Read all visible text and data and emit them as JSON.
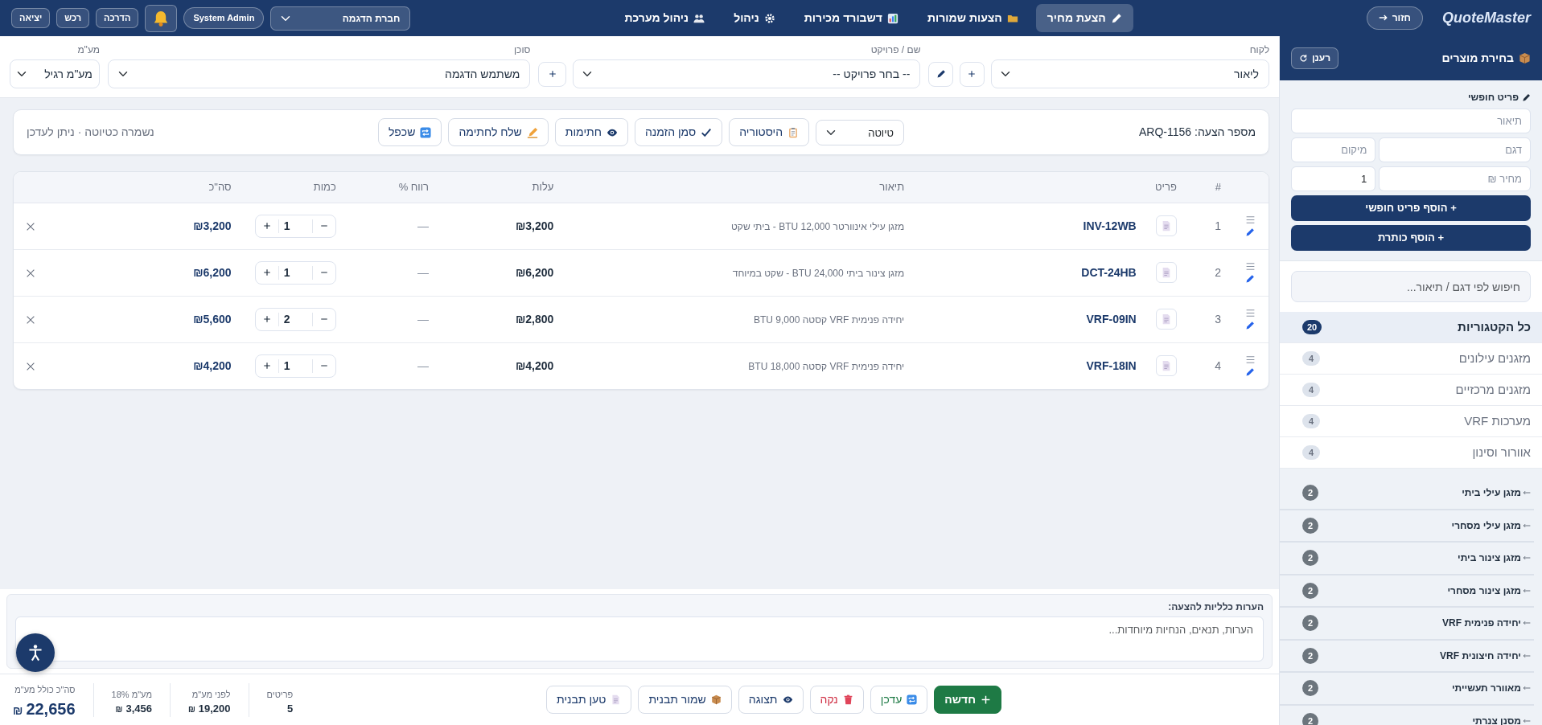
{
  "topbar": {
    "logo": "QuoteMaster",
    "back_button": "חזור",
    "nav": [
      {
        "label": "הצעת מחיר",
        "selected": true
      },
      {
        "label": "הצעות שמורות",
        "selected": false
      },
      {
        "label": "דשבורד מכירות",
        "selected": false
      },
      {
        "label": "ניהול",
        "selected": false
      },
      {
        "label": "ניהול מערכת",
        "selected": false
      }
    ],
    "company": "חברת הדגמה",
    "user": "System Admin",
    "buttons": [
      "הדרכה",
      "רכש",
      "יציאה"
    ]
  },
  "quote_fields": [
    {
      "label": "לקוח",
      "value": "ליאור",
      "actions": [
        {
          "kind": "add"
        },
        {
          "kind": "edit"
        }
      ]
    },
    {
      "label": "שם / פרויקט",
      "value": "-- בחר פרויקט --",
      "actions": [
        {
          "kind": "add"
        }
      ]
    },
    {
      "label": "סוכן",
      "value": "משתמש הדגמה"
    },
    {
      "label": "מע\"מ",
      "value": "מע\"מ רגיל"
    }
  ],
  "toolbar": {
    "quote_number": "מספר הצעה: ARQ-1156",
    "status": "טיוטה",
    "buttons": [
      "היסטוריה",
      "סמן הזמנה",
      "חתימות",
      "שלח לחתימה",
      "שכפל"
    ],
    "save_state": "נשמרה כטיוטה · ניתן לעדכן"
  },
  "table": {
    "columns": [
      "#",
      "פריט",
      "תיאור",
      "עלות",
      "רווח %",
      "כמות",
      "סה\"כ"
    ],
    "rows": [
      {
        "index": "1",
        "sku": "INV-12WB",
        "description": "מזגן עילי אינוורטר 12,000 BTU - ביתי שקט",
        "cost": "₪3,200",
        "profit": "—",
        "qty": "1",
        "total": "₪3,200"
      },
      {
        "index": "2",
        "sku": "DCT-24HB",
        "description": "מזגן צינור ביתי 24,000 BTU - שקט במיוחד",
        "cost": "₪6,200",
        "profit": "—",
        "qty": "1",
        "total": "₪6,200"
      },
      {
        "index": "3",
        "sku": "VRF-09IN",
        "description": "יחידה פנימית VRF קסטה 9,000 BTU",
        "cost": "₪2,800",
        "profit": "—",
        "qty": "2",
        "total": "₪5,600"
      },
      {
        "index": "4",
        "sku": "VRF-18IN",
        "description": "יחידה פנימית VRF קסטה 18,000 BTU",
        "cost": "₪4,200",
        "profit": "—",
        "qty": "1",
        "total": "₪4,200"
      }
    ]
  },
  "notes": {
    "label": "הערות כלליות להצעה:",
    "placeholder": "הערות, תנאים, הנחיות מיוחדות..."
  },
  "footer": {
    "buttons": [
      {
        "label": "חדשה",
        "kind": "new"
      },
      {
        "label": "עדכן",
        "kind": "update"
      },
      {
        "label": "נקה",
        "kind": "clear"
      },
      {
        "label": "תצוגה",
        "kind": "preview"
      },
      {
        "label": "שמור תבנית",
        "kind": "save"
      },
      {
        "label": "טען תבנית",
        "kind": "load"
      }
    ],
    "summary": [
      {
        "label": "פריטים",
        "value": "5",
        "kind": "plain"
      },
      {
        "label": "לפני מע\"מ",
        "value": "19,200",
        "currency": "₪",
        "kind": "plain"
      },
      {
        "label": "מע\"מ 18%",
        "value": "3,456",
        "currency": "₪",
        "kind": "plain"
      },
      {
        "label": "סה\"כ כולל מע\"מ",
        "value": "22,656",
        "currency": "₪",
        "kind": "grand"
      }
    ]
  },
  "sidebar": {
    "title": "בחירת מוצרים",
    "refresh": "רענן",
    "free_item": {
      "title": "פריט חופשי",
      "description_placeholder": "תיאור",
      "model_placeholder": "דגם",
      "location_placeholder": "מיקום",
      "price_placeholder": "מחיר ₪",
      "quantity": "1",
      "add_button": "+ הוסף פריט חופשי",
      "heading_button": "+ הוסף כותרת"
    },
    "search_placeholder": "חיפוש לפי דגם / תיאור...",
    "categories": [
      {
        "label": "כל הקטגוריות",
        "count": "20",
        "selected": true
      },
      {
        "label": "מזגנים עילונים",
        "count": "4",
        "selected": false
      },
      {
        "label": "מזגנים מרכזיים",
        "count": "4",
        "selected": false
      },
      {
        "label": "מערכות VRF",
        "count": "4",
        "selected": false
      },
      {
        "label": "אוורור וסינון",
        "count": "4",
        "selected": false
      }
    ],
    "groups": [
      {
        "label": "מזגן עילי ביתי",
        "count": "2"
      },
      {
        "label": "מזגן עילי מסחרי",
        "count": "2"
      },
      {
        "label": "מזגן צינור ביתי",
        "count": "2"
      },
      {
        "label": "מזגן צינור מסחרי",
        "count": "2"
      },
      {
        "label": "יחידה פנימית VRF",
        "count": "2"
      },
      {
        "label": "יחידה חיצונית VRF",
        "count": "2"
      },
      {
        "label": "מאוורר תעשייתי",
        "count": "2"
      },
      {
        "label": "מסנן צנרתי",
        "count": "2"
      }
    ]
  }
}
